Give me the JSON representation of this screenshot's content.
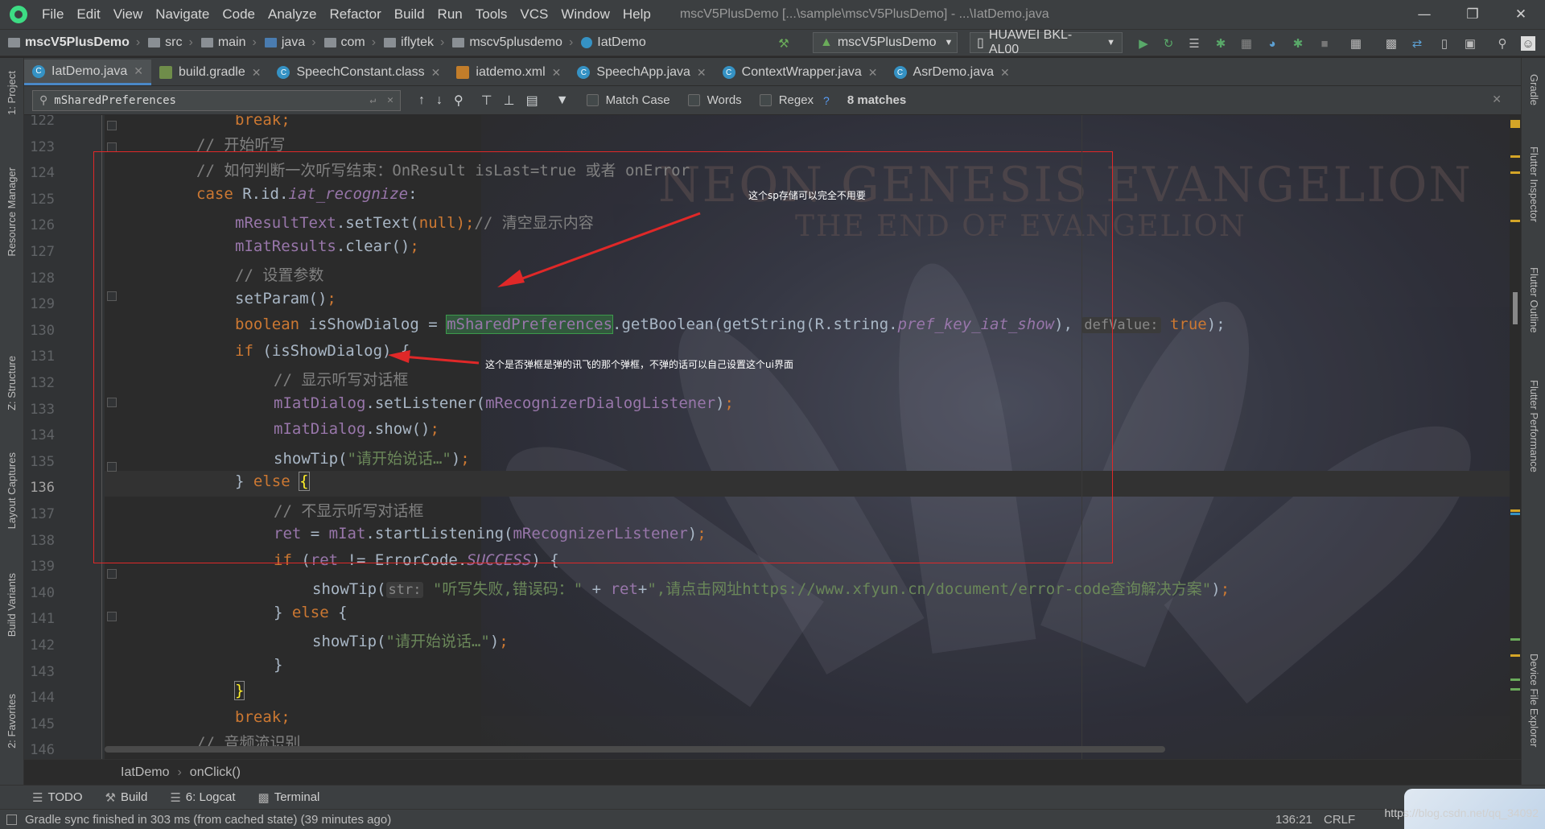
{
  "menu": {
    "items": [
      "File",
      "Edit",
      "View",
      "Navigate",
      "Code",
      "Analyze",
      "Refactor",
      "Build",
      "Run",
      "Tools",
      "VCS",
      "Window",
      "Help"
    ],
    "title": "mscV5PlusDemo [...\\sample\\mscV5PlusDemo] - ...\\IatDemo.java"
  },
  "nav": {
    "crumbs": [
      "mscV5PlusDemo",
      "src",
      "main",
      "java",
      "com",
      "iflytek",
      "mscv5plusdemo",
      "IatDemo"
    ],
    "run_config": "mscV5PlusDemo",
    "device": "HUAWEI BKL-AL00"
  },
  "tabs": [
    "IatDemo.java",
    "build.gradle",
    "SpeechConstant.class",
    "iatdemo.xml",
    "SpeechApp.java",
    "ContextWrapper.java",
    "AsrDemo.java"
  ],
  "find": {
    "query": "mSharedPreferences",
    "match_case": "Match Case",
    "words": "Words",
    "regex": "Regex",
    "help": "?",
    "matches": "8 matches"
  },
  "left_tools": [
    "1: Project",
    "Resource Manager",
    "Z: Structure",
    "Layout Captures",
    "Build Variants",
    "2: Favorites"
  ],
  "right_tools": [
    "Gradle",
    "Flutter Inspector",
    "Flutter Outline",
    "Flutter Performance",
    "Device File Explorer"
  ],
  "background_text": {
    "line1": "NEON GENESIS EVANGELION",
    "line2": "THE END OF EVANGELION"
  },
  "code": {
    "line_numbers": [
      "122",
      "123",
      "124",
      "125",
      "126",
      "127",
      "128",
      "129",
      "130",
      "131",
      "132",
      "133",
      "134",
      "135",
      "136",
      "137",
      "138",
      "139",
      "140",
      "141",
      "142",
      "143",
      "144",
      "145",
      "146"
    ],
    "current_line": "136",
    "l122": {
      "a": "break;"
    },
    "l123": {
      "a": "// 开始听写"
    },
    "l124": {
      "a": "// 如何判断一次听写结束：OnResult isLast=true 或者 onError"
    },
    "l125": {
      "a": "case ",
      "b": "R.id.",
      "c": "iat_recognize",
      "d": ":"
    },
    "l126": {
      "a": "mResultText",
      "b": ".setText(",
      "c": "null",
      "d": ");",
      "e": "// 清空显示内容"
    },
    "l127": {
      "a": "mIatResults",
      "b": ".clear()",
      "c": ";"
    },
    "l128": {
      "a": "// 设置参数"
    },
    "l129": {
      "a": "setParam()",
      "b": ";"
    },
    "l130": {
      "a": "boolean ",
      "b": "isShowDialog = ",
      "c": "mSharedPreferences",
      "d": ".getBoolean(getString(R.string.",
      "e": "pref_key_iat_show",
      "f": "), ",
      "g": "defValue:",
      "h": " true",
      "i": ");"
    },
    "l131": {
      "a": "if ",
      "b": "(isShowDialog) {"
    },
    "l132": {
      "a": "// 显示听写对话框"
    },
    "l133": {
      "a": "mIatDialog",
      "b": ".setListener(",
      "c": "mRecognizerDialogListener",
      "d": ")",
      "e": ";"
    },
    "l134": {
      "a": "mIatDialog",
      "b": ".show()",
      "c": ";"
    },
    "l135": {
      "a": "showTip(",
      "b": "\"请开始说话…\"",
      "c": ")",
      "d": ";"
    },
    "l136": {
      "a": "} ",
      "b": "else ",
      "c": "{"
    },
    "l137": {
      "a": "// 不显示听写对话框"
    },
    "l138": {
      "a": "ret",
      "b": " = ",
      "c": "mIat",
      "d": ".startListening(",
      "e": "mRecognizerListener",
      "f": ")",
      "g": ";"
    },
    "l139": {
      "a": "if ",
      "b": "(",
      "c": "ret",
      "d": " != ErrorCode.",
      "e": "SUCCESS",
      "f": ") {"
    },
    "l140": {
      "a": "showTip(",
      "b": "str:",
      "c": " \"听写失败,错误码：\"",
      "d": " + ",
      "e": "ret",
      "f": "+",
      "g": "\",请点击网址https://www.xfyun.cn/document/error-code查询解决方案\"",
      "h": ")",
      "i": ";"
    },
    "l141": {
      "a": "} ",
      "b": "else ",
      "c": "{"
    },
    "l142": {
      "a": "showTip(",
      "b": "\"请开始说话…\"",
      "c": ")",
      "d": ";"
    },
    "l143": {
      "a": "}"
    },
    "l144": {
      "a": "}"
    },
    "l145": {
      "a": "break;"
    },
    "l146": {
      "a": "// 音频流识别"
    }
  },
  "annotations": {
    "sp_note": "这个sp存储可以完全不用要",
    "dialog_note": "这个是否弹框是弹的讯飞的那个弹框，不弹的话可以自己设置这个ui界面"
  },
  "breadcrumb": {
    "class": "IatDemo",
    "method": "onClick()"
  },
  "toolwindows": [
    "TODO",
    "Build",
    "6: Logcat",
    "Terminal"
  ],
  "status": {
    "message": "Gradle sync finished in 303 ms (from cached state) (39 minutes ago)",
    "position": "136:21",
    "line_sep": "CRLF",
    "watermark": "https://blog.csdn.net/qq_34092"
  },
  "colors": {
    "keyword": "#cc7832",
    "field": "#9876aa",
    "comment": "#808080",
    "string": "#6a8759",
    "annotation_box": "#e02828"
  }
}
